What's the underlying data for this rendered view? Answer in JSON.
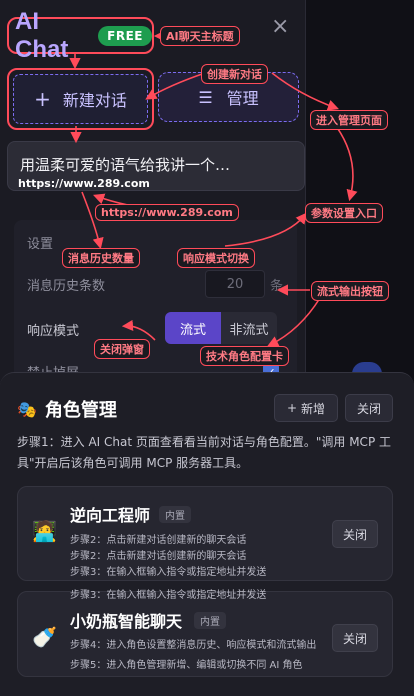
{
  "header": {
    "title": "AI Chat",
    "badge": "FREE",
    "close": "×"
  },
  "actions": {
    "new_chat": "新建对话",
    "manage": "管理"
  },
  "history": {
    "title": "用温柔可爱的语气给我讲一个…",
    "url": "https://www.289.com"
  },
  "settings": {
    "title": "设置",
    "history_count_label": "消息历史条数",
    "history_count_value": "20",
    "history_count_unit": "条",
    "response_mode_label": "响应模式",
    "mode_stream": "流式",
    "mode_non_stream": "非流式",
    "disable_label": "禁止掉屏"
  },
  "annotations": {
    "main_title": "AI聊天主标题",
    "create_chat": "创建新对话",
    "enter_manage": "进入管理页面",
    "url_note": "https://www.289.com",
    "param_entry": "参数设置入口",
    "history_count": "消息历史数量",
    "mode_switch": "响应模式切换",
    "stream_button": "流式输出按钮",
    "close_popup": "关闭弹窗",
    "role_config": "技术角色配置卡"
  },
  "sheet": {
    "title": "角色管理",
    "add_button": "新增",
    "close_button": "关闭",
    "description": "步骤1：进入 AI Chat 页面查看看当前对话与角色配置。\"调用 MCP 工具\"开启后该角色可调用 MCP 服务器工具。",
    "roles": [
      {
        "name": "逆向工程师",
        "badge": "内置",
        "close": "关闭",
        "steps": [
          "步骤2：点击新建对话创建新的聊天会话",
          "步骤2：点击新建对话创建新的聊天会话",
          "步骤3：在输入框输入指令或指定地址并发送",
          "步骤3：在输入框输入指令或指定地址并发送"
        ]
      },
      {
        "name": "小奶瓶智能聊天",
        "badge": "内置",
        "close": "关闭",
        "steps": [
          "步骤4：进入角色设置整消息历史、响应模式和流式输出",
          "步骤5：进入角色管理新增、编辑或切换不同 AI 角色"
        ]
      }
    ]
  },
  "colors": {
    "accent": "#5b45c8",
    "annotation": "#ff4b5a",
    "badge_green": "#1e9d4f"
  }
}
